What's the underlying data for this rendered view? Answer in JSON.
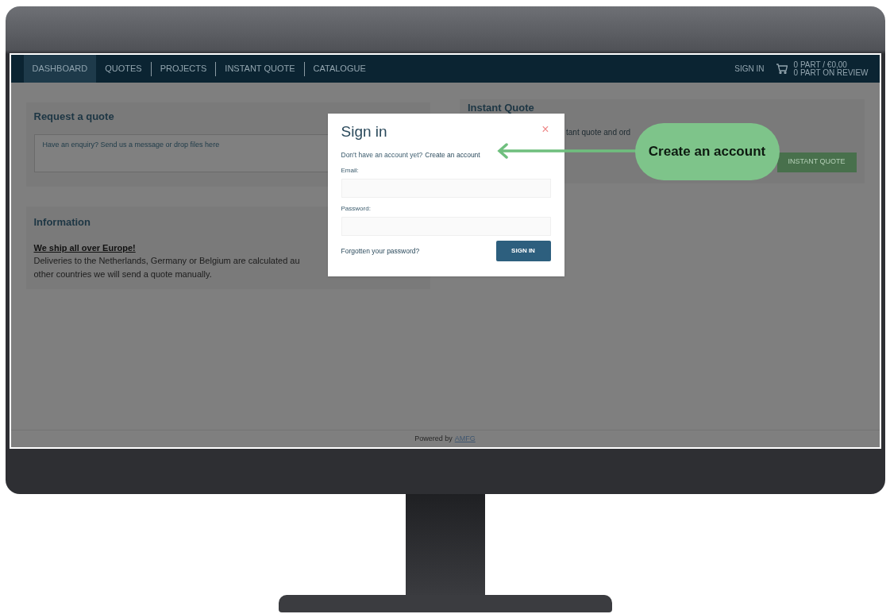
{
  "nav": {
    "items": [
      {
        "label": "DASHBOARD",
        "selected": true
      },
      {
        "label": "QUOTES",
        "selected": false
      },
      {
        "label": "PROJECTS",
        "selected": false
      },
      {
        "label": "INSTANT QUOTE",
        "selected": false
      },
      {
        "label": "CATALOGUE",
        "selected": false
      }
    ],
    "sign_in": "SIGN IN",
    "cart": [
      "0 PART / €0,00",
      "0 PART ON REVIEW"
    ]
  },
  "request_quote": {
    "title": "Request a quote",
    "placeholder": "Have an enquiry? Send us a message or drop files here"
  },
  "information": {
    "title": "Information",
    "link": "We ship all over Europe!",
    "text": "Deliveries to the Netherlands, Germany or Belgium are calculated au",
    "text_2": "other countries we will send a quote manually."
  },
  "instant_quote": {
    "title": "Instant Quote",
    "text": "tant quote and ord",
    "button": "INSTANT QUOTE"
  },
  "footer": {
    "text": "Powered by",
    "link": "AMFG"
  },
  "modal": {
    "title": "Sign in",
    "close": "×",
    "prompt": "Don't have an account yet?",
    "create_link": "Create an account",
    "email_label": "Email:",
    "password_label": "Password:",
    "forgot_link": "Forgotten your password?",
    "submit": "SIGN IN"
  },
  "callout": {
    "text": "Create an account"
  }
}
